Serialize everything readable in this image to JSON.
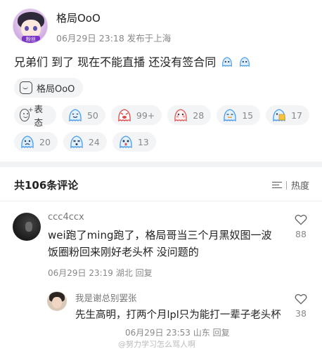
{
  "post": {
    "username": "格局OoO",
    "badge": "粉丝",
    "date": "06月29日 23:18",
    "location": "发布于上海",
    "content": "兄弟们 到了 现在不能直播 还没有签合同",
    "mention_label": "格局OoO"
  },
  "reactions": {
    "express_label": "表态",
    "items": [
      {
        "icon": "smile-ghost-icon",
        "count": "50"
      },
      {
        "icon": "angry-ghost-icon",
        "count": "99+"
      },
      {
        "icon": "shy-ghost-icon",
        "count": "28"
      },
      {
        "icon": "sly-ghost-icon",
        "count": "15"
      },
      {
        "icon": "book-ghost-icon",
        "count": "17"
      },
      {
        "icon": "sad-ghost-icon",
        "count": "20"
      },
      {
        "icon": "dizzy-ghost-icon",
        "count": "24"
      },
      {
        "icon": "surprised-ghost-icon",
        "count": "13"
      }
    ]
  },
  "comments_header": {
    "title": "共106条评论",
    "sort_label": "热度"
  },
  "comments": [
    {
      "user": "ccc4ccx",
      "text": "wei跑了ming跑了，格局哥当三个月黑奴图一波饭圈粉回来刚好老头杯 没问题的",
      "date": "06月29日 23:19",
      "location": "湖北",
      "reply_label": "回复",
      "likes": "88"
    },
    {
      "user": "我是谢总别罢张",
      "text": "先生高明，打两个月lpl只为能打一辈子老头杯",
      "date": "06月29日 23:53",
      "location": "山东",
      "reply_label": "回复",
      "likes": "38"
    }
  ],
  "watermark": "@努力学习怎么骂人啊",
  "colors": {
    "ghost_blue": "#4a9be8",
    "chip_bg": "#f3f4f6",
    "meta_gray": "#888888"
  }
}
